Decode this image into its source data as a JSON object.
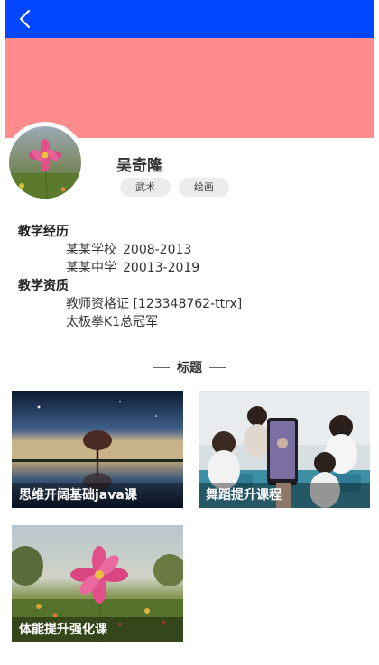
{
  "header": {
    "back_icon": "chevron-left-icon",
    "bar_color": "#0247ff"
  },
  "banner": {
    "color": "#ff8c8c"
  },
  "profile": {
    "name": "吴奇隆",
    "tags": [
      "武术",
      "绘画"
    ]
  },
  "experience": {
    "heading": "教学经历",
    "items": [
      {
        "school": "某某学校",
        "years": "2008-2013"
      },
      {
        "school": "某某中学",
        "years": "20013-2019"
      }
    ]
  },
  "qualifications": {
    "heading": "教学资质",
    "items": [
      "教师资格证 [123348762-ttrx]",
      "太极拳K1总冠军"
    ]
  },
  "section_title": "标题",
  "courses": [
    {
      "title": "思维开阔基础java课"
    },
    {
      "title": "舞蹈提升课程"
    },
    {
      "title": "体能提升强化课"
    }
  ]
}
